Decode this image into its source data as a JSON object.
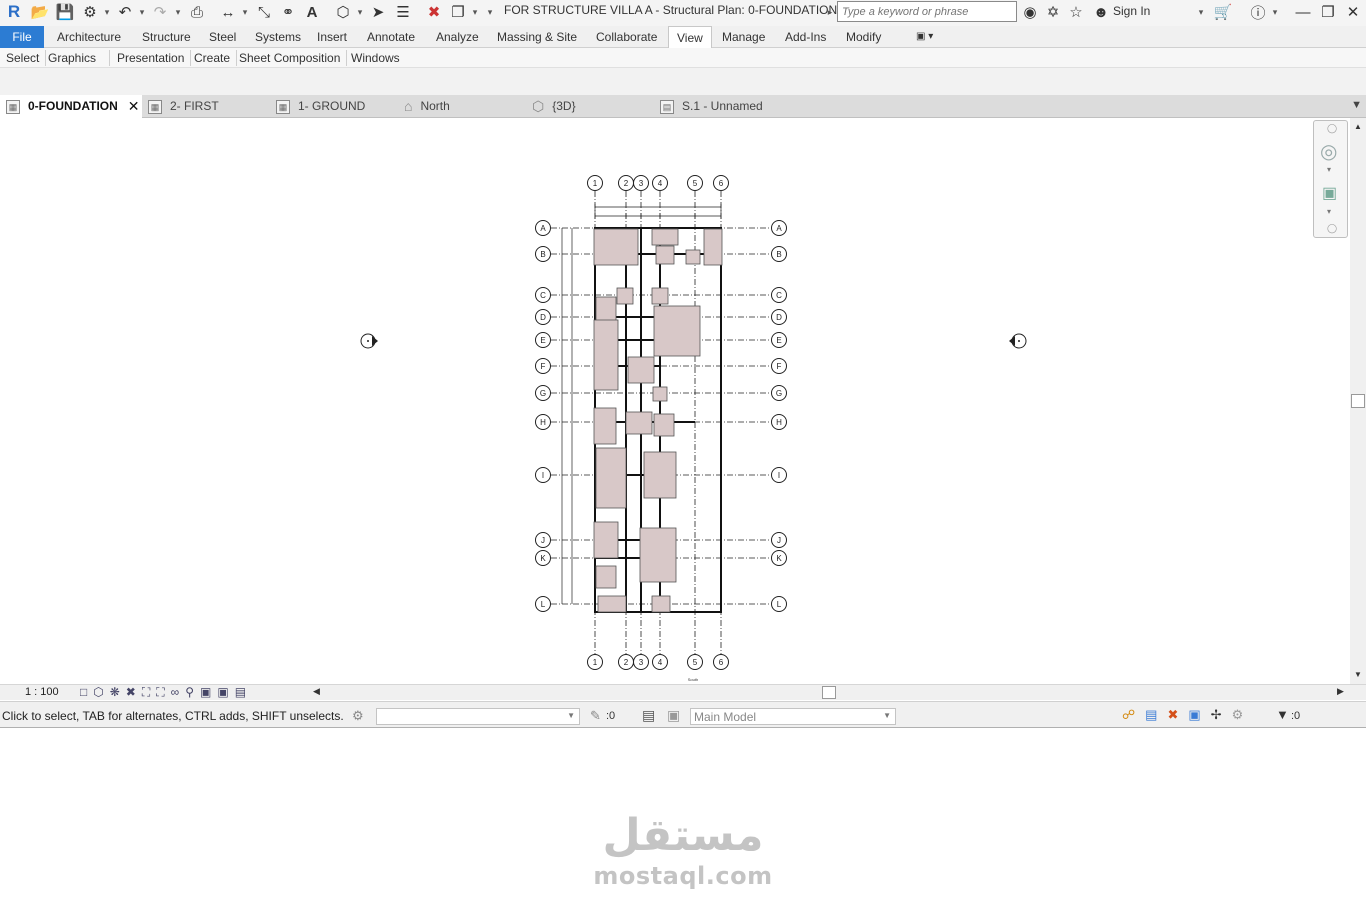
{
  "window": {
    "title": "FOR STRUCTURE VILLA A - Structural Plan: 0-FOUNDATION",
    "search_placeholder": "Type a keyword or phrase",
    "sign_in": "Sign In"
  },
  "ribbon": {
    "file_label": "File",
    "tabs": [
      "Architecture",
      "Structure",
      "Steel",
      "Systems",
      "Insert",
      "Annotate",
      "Analyze",
      "Massing & Site",
      "Collaborate",
      "View",
      "Manage",
      "Add-Ins",
      "Modify"
    ],
    "active_tab": "View",
    "panels": [
      "Select",
      "Graphics",
      "Presentation",
      "Create",
      "Sheet Composition",
      "Windows"
    ]
  },
  "view_tabs": [
    {
      "label": "0-FOUNDATION",
      "icon": "plan-view-icon",
      "active": true
    },
    {
      "label": "2- FIRST",
      "icon": "plan-view-icon",
      "active": false
    },
    {
      "label": "1- GROUND",
      "icon": "plan-view-icon",
      "active": false
    },
    {
      "label": "North",
      "icon": "elevation-view-icon",
      "active": false
    },
    {
      "label": "{3D}",
      "icon": "3d-view-icon",
      "active": false
    },
    {
      "label": "S.1 - Unnamed",
      "icon": "sheet-view-icon",
      "active": false
    }
  ],
  "drawing": {
    "vertical_grids": [
      "1",
      "2",
      "3",
      "4",
      "5",
      "6"
    ],
    "horizontal_grids": [
      "A",
      "B",
      "C",
      "D",
      "E",
      "F",
      "G",
      "H",
      "I",
      "J",
      "K",
      "L"
    ],
    "south_label": "South"
  },
  "view_control": {
    "scale": "1 : 100"
  },
  "status_bar": {
    "prompt": "Click to select, TAB for alternates, CTRL adds, SHIFT unselects.",
    "selection_count": ":0",
    "workset": "Main Model",
    "filter_count": ":0"
  },
  "watermark": {
    "arabic": "مستقل",
    "latin": "mostaql.com"
  },
  "colors": {
    "file_tab": "#2c7cd3",
    "footing_fill": "#d8c8c8",
    "grid_line": "#222222"
  }
}
